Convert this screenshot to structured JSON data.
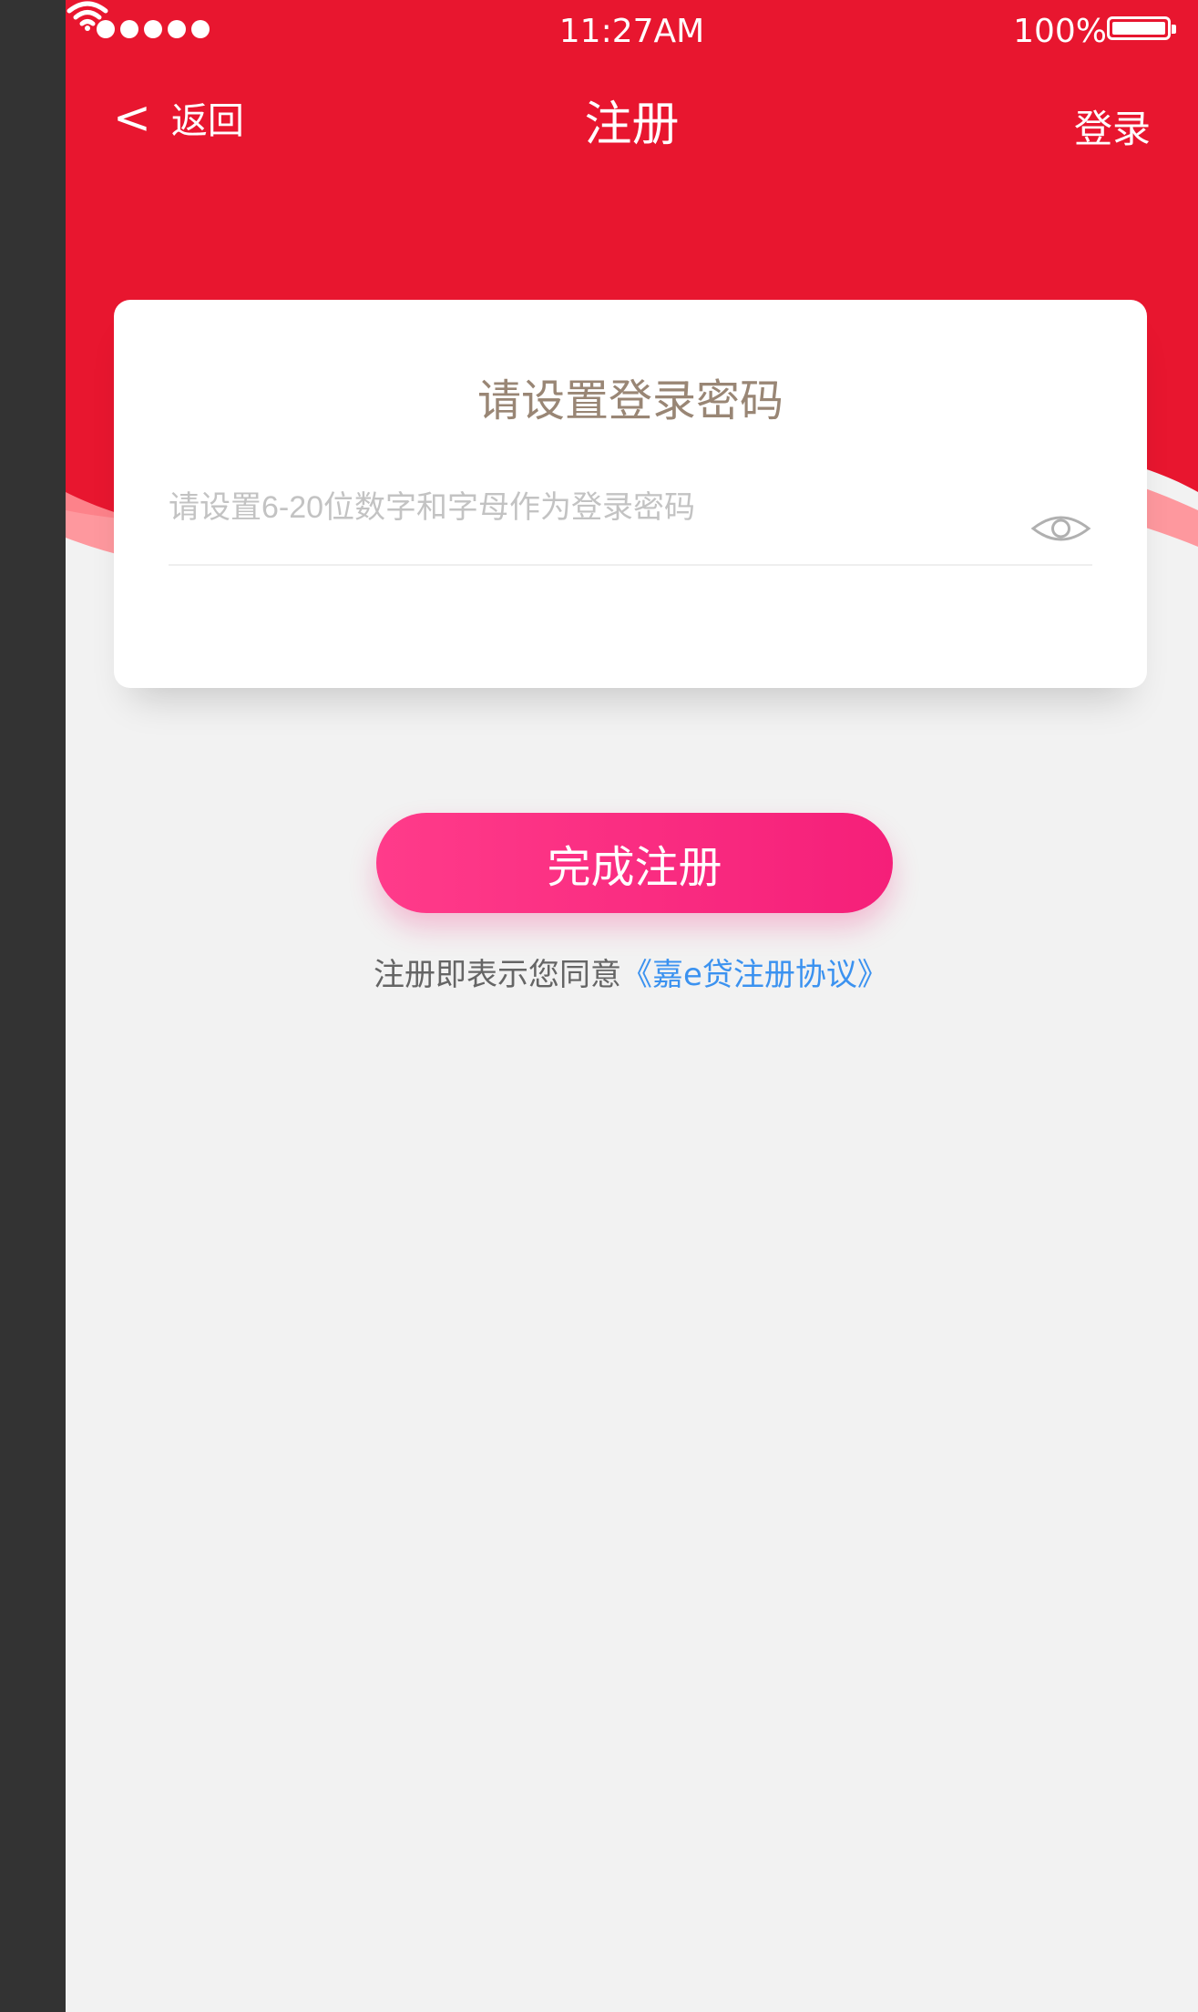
{
  "status_bar": {
    "time": "11:27AM",
    "battery": "100%"
  },
  "nav": {
    "back_label": "返回",
    "title": "注册",
    "right_action": "登录"
  },
  "card": {
    "title": "请设置登录密码",
    "password_placeholder": "请设置6-20位数字和字母作为登录密码",
    "password_value": ""
  },
  "submit_label": "完成注册",
  "agreement": {
    "prefix": "注册即表示您同意",
    "link": "《嘉e贷注册协议》"
  },
  "colors": {
    "brand_red": "#e8162f",
    "title_text": "#998675",
    "placeholder": "#c3c3c3",
    "agreement_text": "#656565",
    "agreement_link": "#3b92f0"
  },
  "icons": [
    "back-chevron-icon",
    "wifi-icon",
    "battery-icon",
    "eye-icon"
  ]
}
